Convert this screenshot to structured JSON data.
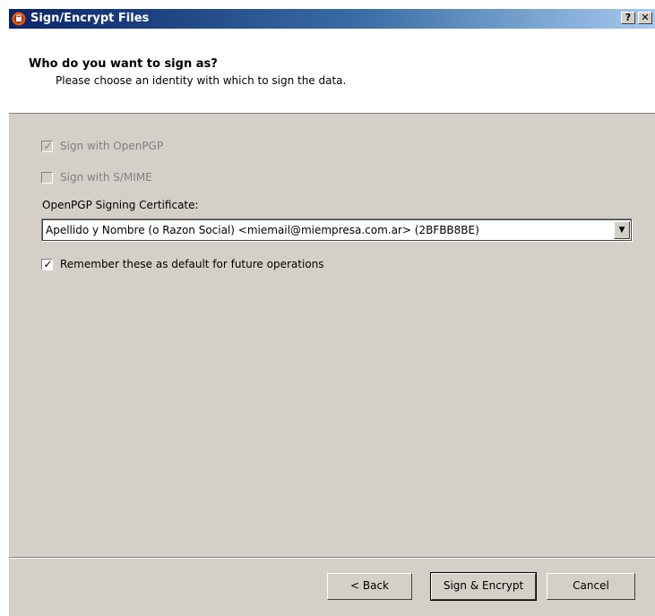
{
  "window": {
    "title": "Sign/Encrypt Files",
    "help_label": "?",
    "close_label": "✕"
  },
  "header": {
    "title": "Who do you want to sign as?",
    "subtitle": "Please choose an identity with which to sign the data."
  },
  "options": {
    "sign_openpgp": {
      "label": "Sign with OpenPGP",
      "checked": true,
      "enabled": false
    },
    "sign_smime": {
      "label": "Sign with S/MIME",
      "checked": false,
      "enabled": false
    },
    "cert_label": "OpenPGP Signing Certificate:",
    "cert_value": "Apellido y Nombre (o Razon Social) <miemail@miempresa.com.ar> (2BFBB8BE)",
    "remember": {
      "label": "Remember these as default for future operations",
      "checked": true,
      "enabled": true
    }
  },
  "buttons": {
    "back": "< Back",
    "sign_encrypt": "Sign & Encrypt",
    "cancel": "Cancel"
  },
  "icons": {
    "app": "kleopatra-app-icon",
    "dropdown": "chevron-down-icon"
  },
  "colors": {
    "titlebar_start": "#0a246a",
    "titlebar_end": "#a6caf0",
    "dialog_bg": "#d4d0c8"
  }
}
